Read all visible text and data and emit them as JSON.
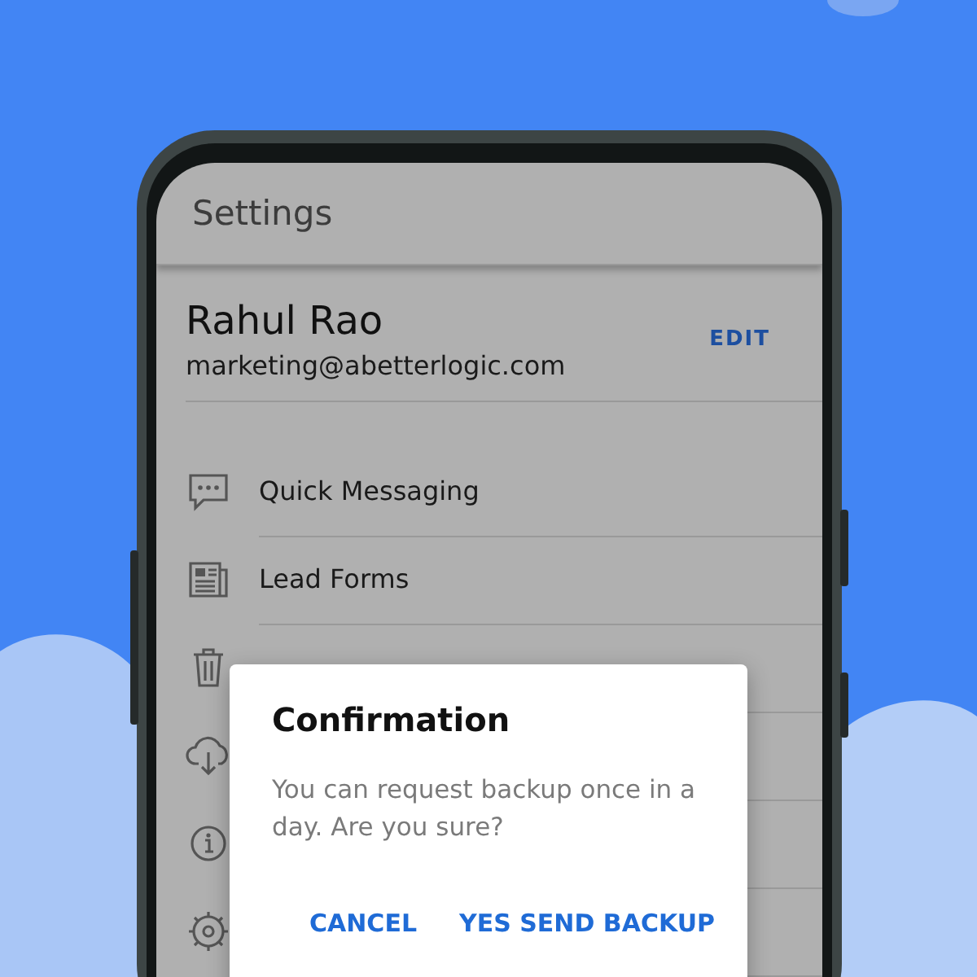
{
  "app_bar": {
    "title": "Settings"
  },
  "profile": {
    "name": "Rahul Rao",
    "email": "marketing@abetterlogic.com",
    "action": "EDIT"
  },
  "menu": {
    "items": [
      {
        "kind": "entry",
        "label": "Quick Messaging"
      },
      {
        "kind": "entry",
        "label": "Lead Forms"
      },
      {
        "kind": "covered"
      },
      {
        "kind": "covered"
      },
      {
        "kind": "covered"
      },
      {
        "kind": "covered"
      }
    ]
  },
  "dialog": {
    "title": "Confirmation",
    "message": "You can request backup once in a day. Are you sure?",
    "buttons": [
      "CANCEL",
      "YES SEND BACKUP"
    ]
  }
}
